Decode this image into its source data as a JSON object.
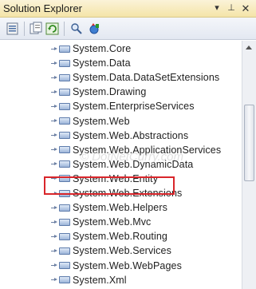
{
  "window": {
    "title": "Solution Explorer",
    "controls": {
      "dropdown": "▾",
      "pin": "⊥",
      "close": "✕"
    }
  },
  "toolbar": {
    "buttons": [
      "properties-icon",
      "show-all-files-icon",
      "refresh-icon",
      "view-class-diagram-icon",
      "copy-website-icon"
    ]
  },
  "tree": {
    "items": [
      {
        "label": "System.Core"
      },
      {
        "label": "System.Data"
      },
      {
        "label": "System.Data.DataSetExtensions"
      },
      {
        "label": "System.Drawing"
      },
      {
        "label": "System.EnterpriseServices"
      },
      {
        "label": "System.Web"
      },
      {
        "label": "System.Web.Abstractions"
      },
      {
        "label": "System.Web.ApplicationServices"
      },
      {
        "label": "System.Web.DynamicData"
      },
      {
        "label": "System.Web.Entity"
      },
      {
        "label": "System.Web.Extensions"
      },
      {
        "label": "System.Web.Helpers"
      },
      {
        "label": "System.Web.Mvc"
      },
      {
        "label": "System.Web.Routing"
      },
      {
        "label": "System.Web.Services"
      },
      {
        "label": "System.Web.WebPages"
      },
      {
        "label": "System.Xml"
      }
    ],
    "highlighted_index": 11
  },
  "watermark": "© DotNetCurry.com",
  "colors": {
    "highlight": "#d9262b",
    "titlebar": "#f4e4a8"
  }
}
